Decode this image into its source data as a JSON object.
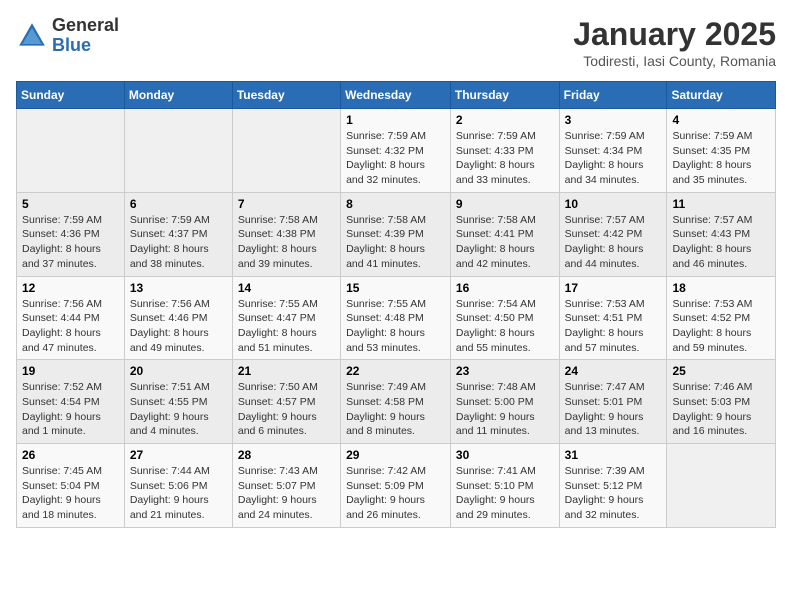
{
  "logo": {
    "general": "General",
    "blue": "Blue"
  },
  "title": "January 2025",
  "subtitle": "Todiresti, Iasi County, Romania",
  "days_of_week": [
    "Sunday",
    "Monday",
    "Tuesday",
    "Wednesday",
    "Thursday",
    "Friday",
    "Saturday"
  ],
  "weeks": [
    [
      {
        "day": "",
        "info": ""
      },
      {
        "day": "",
        "info": ""
      },
      {
        "day": "",
        "info": ""
      },
      {
        "day": "1",
        "info": "Sunrise: 7:59 AM\nSunset: 4:32 PM\nDaylight: 8 hours and 32 minutes."
      },
      {
        "day": "2",
        "info": "Sunrise: 7:59 AM\nSunset: 4:33 PM\nDaylight: 8 hours and 33 minutes."
      },
      {
        "day": "3",
        "info": "Sunrise: 7:59 AM\nSunset: 4:34 PM\nDaylight: 8 hours and 34 minutes."
      },
      {
        "day": "4",
        "info": "Sunrise: 7:59 AM\nSunset: 4:35 PM\nDaylight: 8 hours and 35 minutes."
      }
    ],
    [
      {
        "day": "5",
        "info": "Sunrise: 7:59 AM\nSunset: 4:36 PM\nDaylight: 8 hours and 37 minutes."
      },
      {
        "day": "6",
        "info": "Sunrise: 7:59 AM\nSunset: 4:37 PM\nDaylight: 8 hours and 38 minutes."
      },
      {
        "day": "7",
        "info": "Sunrise: 7:58 AM\nSunset: 4:38 PM\nDaylight: 8 hours and 39 minutes."
      },
      {
        "day": "8",
        "info": "Sunrise: 7:58 AM\nSunset: 4:39 PM\nDaylight: 8 hours and 41 minutes."
      },
      {
        "day": "9",
        "info": "Sunrise: 7:58 AM\nSunset: 4:41 PM\nDaylight: 8 hours and 42 minutes."
      },
      {
        "day": "10",
        "info": "Sunrise: 7:57 AM\nSunset: 4:42 PM\nDaylight: 8 hours and 44 minutes."
      },
      {
        "day": "11",
        "info": "Sunrise: 7:57 AM\nSunset: 4:43 PM\nDaylight: 8 hours and 46 minutes."
      }
    ],
    [
      {
        "day": "12",
        "info": "Sunrise: 7:56 AM\nSunset: 4:44 PM\nDaylight: 8 hours and 47 minutes."
      },
      {
        "day": "13",
        "info": "Sunrise: 7:56 AM\nSunset: 4:46 PM\nDaylight: 8 hours and 49 minutes."
      },
      {
        "day": "14",
        "info": "Sunrise: 7:55 AM\nSunset: 4:47 PM\nDaylight: 8 hours and 51 minutes."
      },
      {
        "day": "15",
        "info": "Sunrise: 7:55 AM\nSunset: 4:48 PM\nDaylight: 8 hours and 53 minutes."
      },
      {
        "day": "16",
        "info": "Sunrise: 7:54 AM\nSunset: 4:50 PM\nDaylight: 8 hours and 55 minutes."
      },
      {
        "day": "17",
        "info": "Sunrise: 7:53 AM\nSunset: 4:51 PM\nDaylight: 8 hours and 57 minutes."
      },
      {
        "day": "18",
        "info": "Sunrise: 7:53 AM\nSunset: 4:52 PM\nDaylight: 8 hours and 59 minutes."
      }
    ],
    [
      {
        "day": "19",
        "info": "Sunrise: 7:52 AM\nSunset: 4:54 PM\nDaylight: 9 hours and 1 minute."
      },
      {
        "day": "20",
        "info": "Sunrise: 7:51 AM\nSunset: 4:55 PM\nDaylight: 9 hours and 4 minutes."
      },
      {
        "day": "21",
        "info": "Sunrise: 7:50 AM\nSunset: 4:57 PM\nDaylight: 9 hours and 6 minutes."
      },
      {
        "day": "22",
        "info": "Sunrise: 7:49 AM\nSunset: 4:58 PM\nDaylight: 9 hours and 8 minutes."
      },
      {
        "day": "23",
        "info": "Sunrise: 7:48 AM\nSunset: 5:00 PM\nDaylight: 9 hours and 11 minutes."
      },
      {
        "day": "24",
        "info": "Sunrise: 7:47 AM\nSunset: 5:01 PM\nDaylight: 9 hours and 13 minutes."
      },
      {
        "day": "25",
        "info": "Sunrise: 7:46 AM\nSunset: 5:03 PM\nDaylight: 9 hours and 16 minutes."
      }
    ],
    [
      {
        "day": "26",
        "info": "Sunrise: 7:45 AM\nSunset: 5:04 PM\nDaylight: 9 hours and 18 minutes."
      },
      {
        "day": "27",
        "info": "Sunrise: 7:44 AM\nSunset: 5:06 PM\nDaylight: 9 hours and 21 minutes."
      },
      {
        "day": "28",
        "info": "Sunrise: 7:43 AM\nSunset: 5:07 PM\nDaylight: 9 hours and 24 minutes."
      },
      {
        "day": "29",
        "info": "Sunrise: 7:42 AM\nSunset: 5:09 PM\nDaylight: 9 hours and 26 minutes."
      },
      {
        "day": "30",
        "info": "Sunrise: 7:41 AM\nSunset: 5:10 PM\nDaylight: 9 hours and 29 minutes."
      },
      {
        "day": "31",
        "info": "Sunrise: 7:39 AM\nSunset: 5:12 PM\nDaylight: 9 hours and 32 minutes."
      },
      {
        "day": "",
        "info": ""
      }
    ]
  ]
}
